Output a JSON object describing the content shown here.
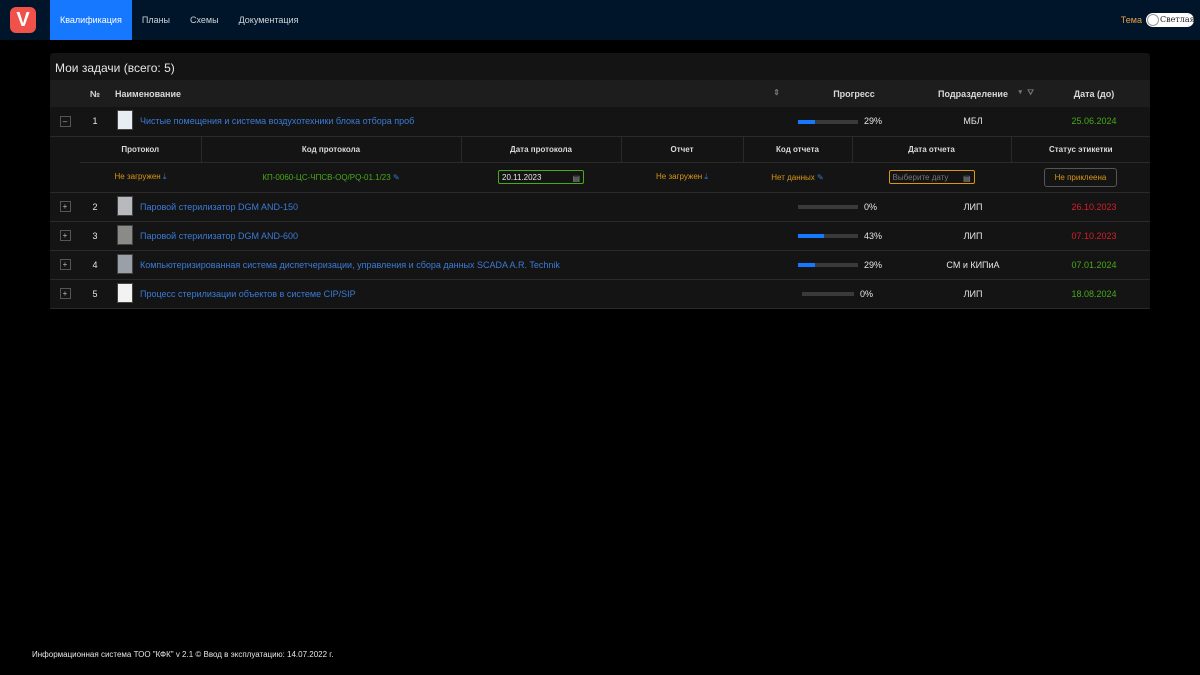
{
  "nav": {
    "items": [
      "Квалификация",
      "Планы",
      "Схемы",
      "Документация"
    ],
    "theme_label": "Тема",
    "theme_toggle": "Светлая"
  },
  "card": {
    "title": "Мои задачи (всего: 5)",
    "columns": {
      "num": "№",
      "name": "Наименование",
      "progress": "Прогресс",
      "division": "Подразделение",
      "date": "Дата (до)"
    }
  },
  "tasks": [
    {
      "num": "1",
      "name": "Чистые помещения и система воздухотехники блока отбора проб",
      "progress": 0.29,
      "pct": "29%",
      "division": "МБЛ",
      "date": "25.06.2024",
      "date_status": "green",
      "expand": "–"
    },
    {
      "num": "2",
      "name": "Паровой стерилизатор DGM AND-150",
      "progress": 0,
      "pct": "0%",
      "division": "ЛИП",
      "date": "26.10.2023",
      "date_status": "red",
      "expand": "+"
    },
    {
      "num": "3",
      "name": "Паровой стерилизатор DGM AND-600",
      "progress": 0.43,
      "pct": "43%",
      "division": "ЛИП",
      "date": "07.10.2023",
      "date_status": "red",
      "expand": "+"
    },
    {
      "num": "4",
      "name": "Компьютеризированная система диспетчеризации, управления и сбора данных SCADA A.R. Technik",
      "progress": 0.29,
      "pct": "29%",
      "division": "СМ и КИПиА",
      "date": "07.01.2024",
      "date_status": "green",
      "expand": "+"
    },
    {
      "num": "5",
      "name": "Процесс стерилизации объектов в системе CIP/SIP",
      "progress": 0,
      "pct": "0%",
      "division": "ЛИП",
      "date": "18.08.2024",
      "date_status": "green",
      "expand": "+"
    }
  ],
  "subtable": {
    "columns": {
      "protocol": "Протокол",
      "protocol_code": "Код протокола",
      "protocol_date": "Дата протокола",
      "report": "Отчет",
      "report_code": "Код отчета",
      "report_date": "Дата отчета",
      "label_status": "Статус этикетки"
    },
    "row": {
      "protocol": "Не загружен",
      "protocol_code": "КП-0060-ЦС-ЧПСВ-OQ/PQ-01.1/23",
      "protocol_date": "20.11.2023",
      "report": "Не загружен",
      "report_code": "Нет данных",
      "report_date_placeholder": "Выберите дату",
      "label_status": "Не приклеена"
    }
  },
  "footer": "Информационная система ТОО \"КФК\" v 2.1 © Ввод в эксплуатацию: 14.07.2022 г.",
  "colors": {
    "accent": "#1677ff",
    "green": "#49aa19",
    "red": "#d32029",
    "orange": "#d89614",
    "topbar": "#001529"
  }
}
